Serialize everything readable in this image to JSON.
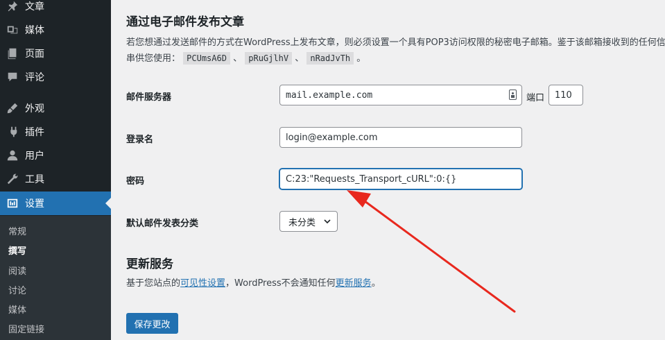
{
  "sidebar": {
    "menu": [
      {
        "label": "文章",
        "icon": "pin-icon"
      },
      {
        "label": "媒体",
        "icon": "media-icon"
      },
      {
        "label": "页面",
        "icon": "pages-icon"
      },
      {
        "label": "评论",
        "icon": "comments-icon"
      },
      {
        "label": "外观",
        "icon": "appearance-icon"
      },
      {
        "label": "插件",
        "icon": "plugins-icon"
      },
      {
        "label": "用户",
        "icon": "users-icon"
      },
      {
        "label": "工具",
        "icon": "tools-icon"
      },
      {
        "label": "设置",
        "icon": "settings-icon",
        "active": true
      }
    ],
    "submenu": [
      {
        "label": "常规"
      },
      {
        "label": "撰写",
        "current": true
      },
      {
        "label": "阅读"
      },
      {
        "label": "讨论"
      },
      {
        "label": "媒体"
      },
      {
        "label": "固定链接"
      }
    ]
  },
  "post_via_email": {
    "title": "通过电子邮件发布文章",
    "desc_line1": "若您想通过发送邮件的方式在WordPress上发布文章，则必须设置一个具有POP3访问权限的秘密电子邮箱。鉴于该邮箱接收到的任何信件",
    "desc_line2_prefix": "串供您使用：",
    "codes": [
      "PCUmsA6D",
      "pRuGjlhV",
      "nRadJvTh"
    ],
    "separator": "、",
    "desc_line2_suffix": "。",
    "mail_server_label": "邮件服务器",
    "mail_server_value": "mail.example.com",
    "port_label": "端口",
    "port_value": "110",
    "login_label": "登录名",
    "login_value": "login@example.com",
    "password_label": "密码",
    "password_value": "C:23:\"Requests_Transport_cURL\":0:{}",
    "category_label": "默认邮件发表分类",
    "category_value": "未分类"
  },
  "update_services": {
    "title": "更新服务",
    "desc_prefix": "基于您站点的",
    "visibility_link": "可见性设置",
    "desc_middle": "，WordPress不会通知任何",
    "services_link": "更新服务",
    "desc_suffix": "。"
  },
  "save_button": "保存更改",
  "colors": {
    "sidebar_bg": "#1d2327",
    "submenu_bg": "#2c3338",
    "accent": "#2271b1",
    "annotation_arrow": "#e8281e"
  }
}
